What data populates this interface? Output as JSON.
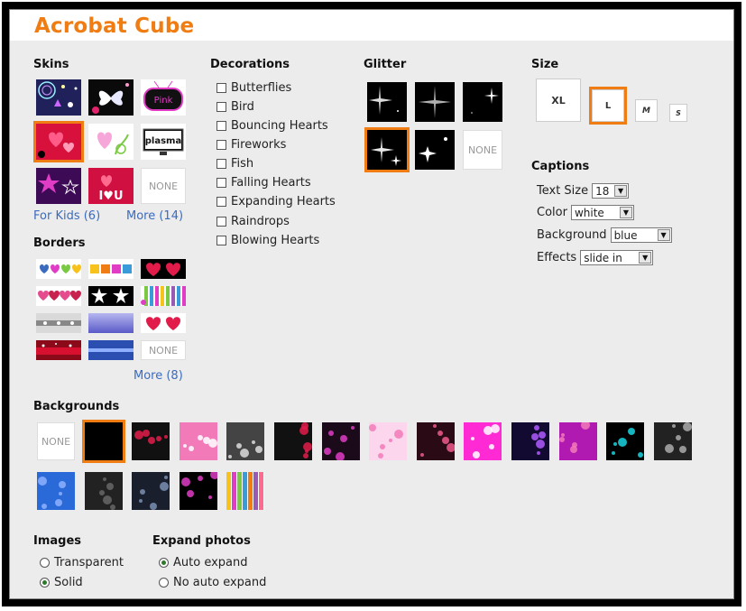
{
  "app": {
    "title": "Acrobat Cube"
  },
  "skins": {
    "header": "Skins",
    "items": [
      {
        "icon": "sparkle-skin"
      },
      {
        "icon": "butterfly-skin"
      },
      {
        "icon": "pink-tv-skin",
        "label": "Pink"
      },
      {
        "icon": "hearts-skin",
        "selected": true
      },
      {
        "icon": "swirl-heart-skin"
      },
      {
        "icon": "plasma-tv-skin",
        "label": "plasma"
      },
      {
        "icon": "stars-skin"
      },
      {
        "icon": "i-love-u-skin",
        "label": "I♥U"
      },
      {
        "icon": "none-skin",
        "label": "NONE"
      }
    ],
    "link_kids": "For Kids (6)",
    "link_more": "More (14)"
  },
  "borders": {
    "header": "Borders",
    "items": [
      {
        "icon": "rainbow-hearts-border"
      },
      {
        "icon": "color-blocks-border"
      },
      {
        "icon": "red-hearts-border"
      },
      {
        "icon": "pink-hearts-border"
      },
      {
        "icon": "white-stars-border"
      },
      {
        "icon": "stripes-border"
      },
      {
        "icon": "silver-border"
      },
      {
        "icon": "purple-gradient-border"
      },
      {
        "icon": "red-hearts-white-border"
      },
      {
        "icon": "red-sparkle-border"
      },
      {
        "icon": "blue-stripe-border"
      },
      {
        "icon": "none-border",
        "label": "NONE"
      }
    ],
    "link_more": "More (8)"
  },
  "decorations": {
    "header": "Decorations",
    "items": [
      "Butterflies",
      "Bird",
      "Bouncing Hearts",
      "Fireworks",
      "Fish",
      "Falling Hearts",
      "Expanding Hearts",
      "Raindrops",
      "Blowing Hearts"
    ]
  },
  "glitter": {
    "header": "Glitter",
    "items": [
      {
        "icon": "glitter-1"
      },
      {
        "icon": "glitter-2"
      },
      {
        "icon": "glitter-3"
      },
      {
        "icon": "glitter-4",
        "selected": true
      },
      {
        "icon": "glitter-5"
      },
      {
        "icon": "none-glitter",
        "label": "NONE"
      }
    ]
  },
  "size": {
    "header": "Size",
    "options": [
      {
        "label": "XL"
      },
      {
        "label": "L",
        "selected": true
      },
      {
        "label": "M"
      },
      {
        "label": "S"
      }
    ]
  },
  "captions": {
    "header": "Captions",
    "text_size_label": "Text Size",
    "text_size_value": "18",
    "color_label": "Color",
    "color_value": "white",
    "background_label": "Background",
    "background_value": "blue",
    "effects_label": "Effects",
    "effects_value": "slide in"
  },
  "backgrounds": {
    "header": "Backgrounds",
    "none_label": "NONE",
    "selected_index": 1
  },
  "images": {
    "header": "Images",
    "options": [
      "Transparent",
      "Solid"
    ],
    "selected": "Solid"
  },
  "expand_photos": {
    "header": "Expand photos",
    "options": [
      "Auto expand",
      "No auto expand"
    ],
    "selected": "Auto expand"
  },
  "colors": {
    "accent": "#f07d13",
    "link": "#3a6bbf",
    "panel": "#ececec"
  }
}
